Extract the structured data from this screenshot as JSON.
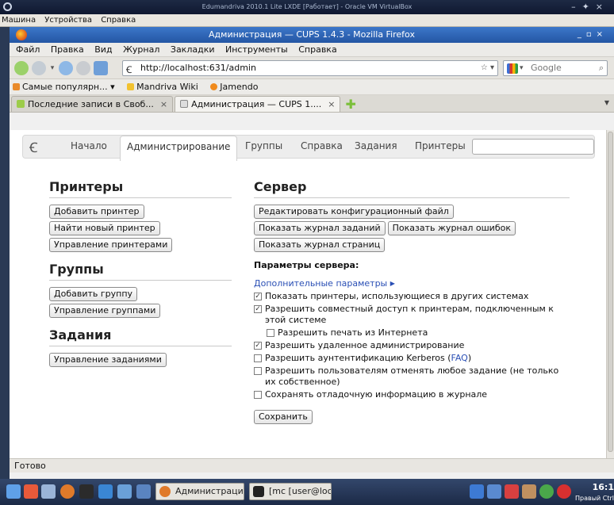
{
  "vbox": {
    "title": "Edumandriva 2010.1 Lite LXDE [Работает] - Oracle VM VirtualBox",
    "menu": [
      "Машина",
      "Устройства",
      "Справка"
    ]
  },
  "firefox": {
    "title": "Администрация — CUPS 1.4.3 - Mozilla Firefox",
    "menu": [
      "Файл",
      "Правка",
      "Вид",
      "Журнал",
      "Закладки",
      "Инструменты",
      "Справка"
    ],
    "url": "http://localhost:631/admin",
    "search_engine": "Google",
    "bookmarks": [
      "Самые популярн...",
      "Mandriva Wiki",
      "Jamendo"
    ],
    "tabs": [
      "Последние записи в Своб...",
      "Администрация — CUPS 1...."
    ],
    "status": "Готово"
  },
  "cups": {
    "nav": [
      "Начало",
      "Администрирование",
      "Группы",
      "Справка",
      "Задания",
      "Принтеры"
    ],
    "printers": {
      "heading": "Принтеры",
      "buttons": [
        "Добавить принтер",
        "Найти новый принтер",
        "Управление принтерами"
      ]
    },
    "groups": {
      "heading": "Группы",
      "buttons": [
        "Добавить группу",
        "Управление группами"
      ]
    },
    "jobs": {
      "heading": "Задания",
      "buttons": [
        "Управление заданиями"
      ]
    },
    "server": {
      "heading": "Сервер",
      "buttons": [
        "Редактировать конфигурационный файл",
        "Показать журнал заданий",
        "Показать журнал ошибок",
        "Показать журнал страниц"
      ],
      "settings_label": "Параметры сервера:",
      "advanced_link": "Дополнительные параметры",
      "options": [
        {
          "label": "Показать принтеры, использующиеся в других системах",
          "checked": true
        },
        {
          "label": "Разрешить совместный доступ к принтерам, подключенным к этой системе",
          "checked": true
        },
        {
          "label": "Разрешить печать из Интернета",
          "checked": false
        },
        {
          "label": "Разрешить удаленное администрирование",
          "checked": true
        },
        {
          "label_prefix": "Разрешить аунтентификацию Kerberos (",
          "label_link": "FAQ",
          "label_suffix": ")",
          "checked": false
        },
        {
          "label": "Разрешить пользователям отменять любое задание (не только их собственное)",
          "checked": false
        },
        {
          "label": "Сохранять отладочную информацию в журнале",
          "checked": false
        }
      ],
      "save_label": "Сохранить"
    }
  },
  "taskbar": {
    "tasks": [
      "Администраци...",
      "[mc [user@loc..."
    ],
    "clock": "16:1",
    "keyboard_label": "Правый Ctrl"
  }
}
